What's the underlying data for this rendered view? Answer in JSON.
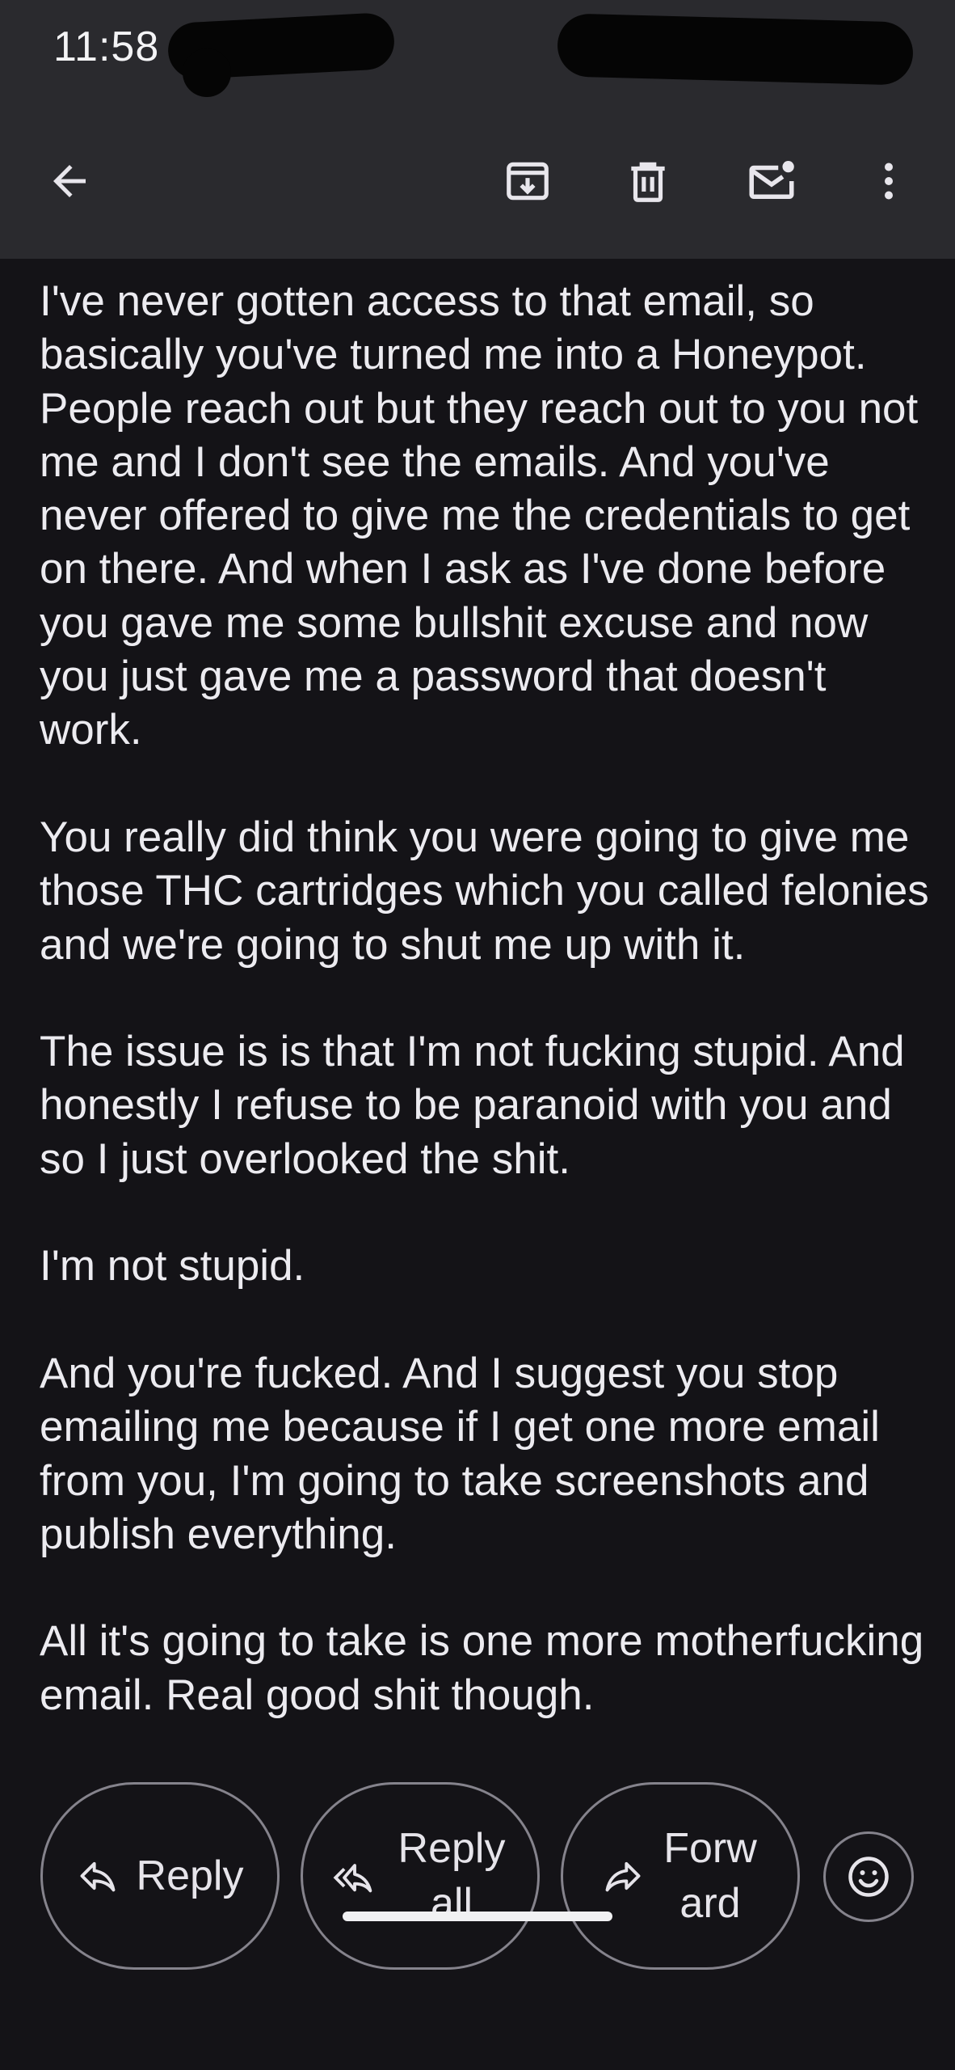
{
  "status_bar": {
    "time": "11:58"
  },
  "toolbar": {
    "icons": [
      "back-arrow-icon",
      "archive-icon",
      "trash-icon",
      "mark-unread-icon",
      "more-vert-icon"
    ]
  },
  "email": {
    "paragraphs": [
      "I've never gotten access to that email, so basically you've turned me into a Honeypot. People reach out but they reach out to you not me and I don't see the emails. And you've never offered to give me the credentials to get on there. And when I ask as I've done before you gave me some bullshit excuse and now you just gave me a password that doesn't work.",
      "You really did think you were going to give me those THC cartridges which you called felonies and we're going to shut me up with it.",
      "The issue is is that I'm not fucking stupid. And honestly I refuse to be paranoid with you and so I just overlooked the shit.",
      "I'm not stupid.",
      "And you're fucked. And I suggest you stop emailing me because if I get one more email from you, I'm going to take screenshots and publish everything.",
      "All it's going to take is one more motherfucking email. Real good shit though."
    ]
  },
  "actions": {
    "reply_label": "Reply",
    "reply_all_label": "Reply all",
    "forward_label": "Forward",
    "emoji_icon": "emoji-smile-icon"
  },
  "colors": {
    "toolbar_bg": "#2a2a2e",
    "content_bg": "#141317",
    "text": "#ecebf0",
    "pill_border": "#85838c"
  }
}
